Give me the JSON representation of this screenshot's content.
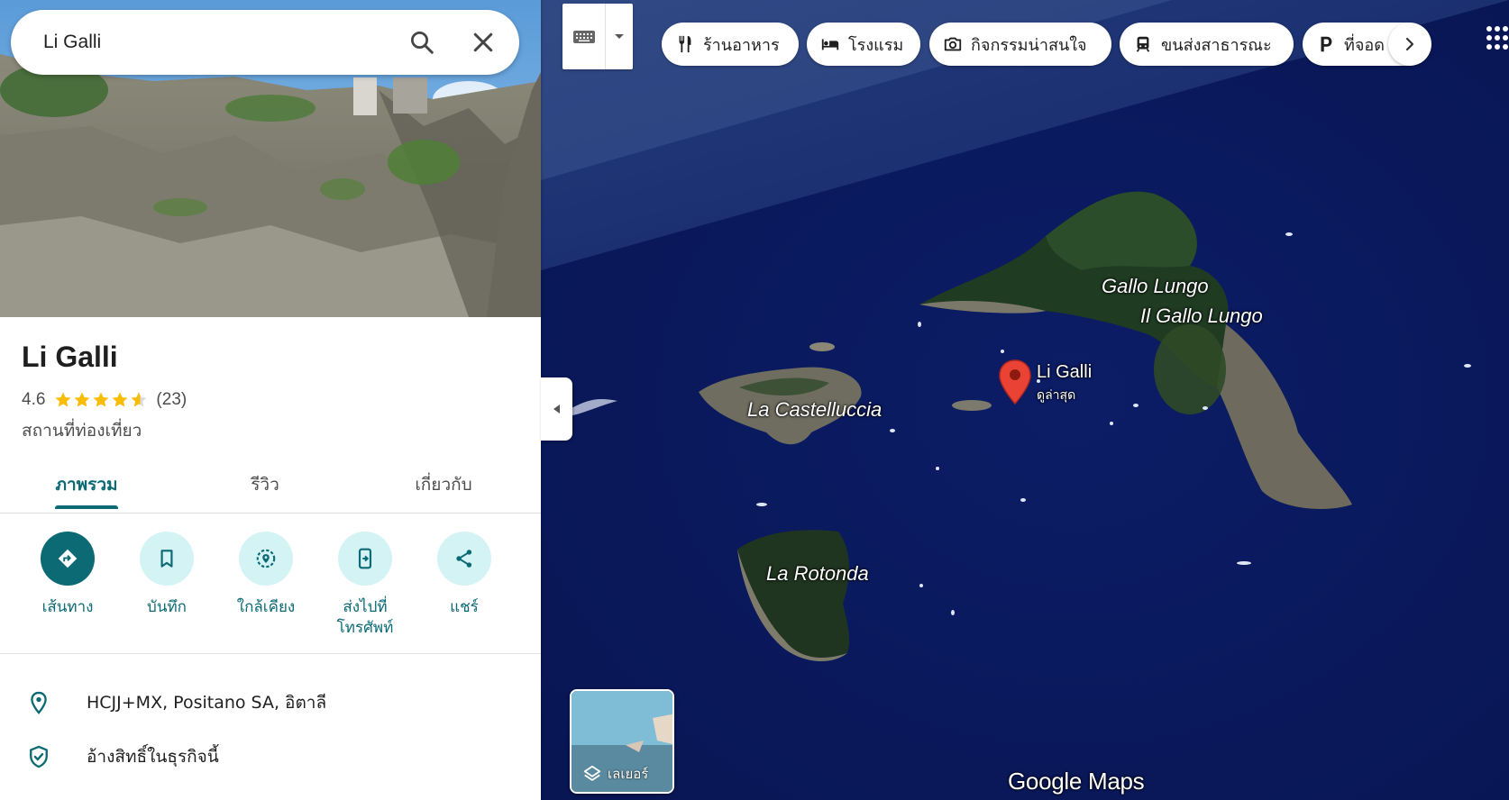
{
  "search": {
    "query": "Li Galli"
  },
  "place": {
    "name": "Li Galli",
    "rating": "4.6",
    "rating_value": 4.6,
    "review_count": "(23)",
    "category": "สถานที่ท่องเที่ยว"
  },
  "tabs": [
    {
      "label": "ภาพรวม",
      "active": true
    },
    {
      "label": "รีวิว",
      "active": false
    },
    {
      "label": "เกี่ยวกับ",
      "active": false
    }
  ],
  "actions": [
    {
      "label": "เส้นทาง",
      "icon": "directions-icon"
    },
    {
      "label": "บันทึก",
      "icon": "bookmark-icon"
    },
    {
      "label": "ใกล้เคียง",
      "icon": "nearby-icon"
    },
    {
      "label": "ส่งไปที่\nโทรศัพท์",
      "icon": "send-to-phone-icon"
    },
    {
      "label": "แชร์",
      "icon": "share-icon"
    }
  ],
  "info": {
    "plus_code": "HCJJ+MX, Positano SA, อิตาลี",
    "claim": "อ้างสิทธิ์ในธุรกิจนี้"
  },
  "chips": [
    {
      "label": "ร้านอาหาร",
      "icon": "restaurant-icon"
    },
    {
      "label": "โรงแรม",
      "icon": "hotel-icon"
    },
    {
      "label": "กิจกรรมน่าสนใจ",
      "icon": "camera-icon"
    },
    {
      "label": "ขนส่งสาธารณะ",
      "icon": "transit-icon"
    },
    {
      "label": "ที่จอด",
      "icon": "parking-icon"
    }
  ],
  "map": {
    "labels": {
      "gallo_lungo": "Gallo Lungo",
      "il_gallo_lungo": "Il Gallo Lungo",
      "castelluccia": "La Castelluccia",
      "rotonda": "La Rotonda"
    },
    "pin": {
      "name": "Li Galli",
      "sub": "ดูล่าสุด"
    },
    "layers_label": "เลเยอร์",
    "logo": "Google Maps"
  },
  "colors": {
    "accent": "#0b6a73",
    "action_bg": "#d4f3f5",
    "sea": "#0b1a5c",
    "pin": "#ea4335",
    "star": "#fbbc04"
  }
}
